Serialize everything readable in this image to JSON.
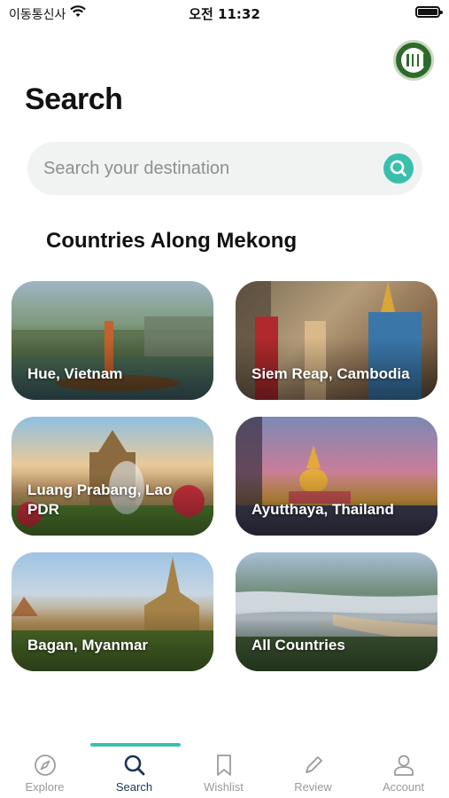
{
  "status_bar": {
    "carrier": "이동통신사",
    "time": "오전 11:32"
  },
  "header": {
    "title": "Search",
    "logo": "heritage-logo-badge"
  },
  "search": {
    "placeholder": "Search your destination",
    "value": "",
    "icon": "search-icon"
  },
  "section": {
    "title": "Countries Along Mekong"
  },
  "destinations": [
    {
      "label": "Hue, Vietnam"
    },
    {
      "label": "Siem Reap, Cambodia"
    },
    {
      "label": "Luang Prabang, Lao PDR"
    },
    {
      "label": "Ayutthaya, Thailand"
    },
    {
      "label": "Bagan, Myanmar"
    },
    {
      "label": "All Countries"
    }
  ],
  "tabs": [
    {
      "label": "Explore",
      "icon": "compass-icon",
      "active": false
    },
    {
      "label": "Search",
      "icon": "search-icon",
      "active": true
    },
    {
      "label": "Wishlist",
      "icon": "bookmark-icon",
      "active": false
    },
    {
      "label": "Review",
      "icon": "pencil-icon",
      "active": false
    },
    {
      "label": "Account",
      "icon": "person-icon",
      "active": false
    }
  ],
  "colors": {
    "accent": "#3bbfad",
    "active_tab": "#1d3557",
    "inactive_tab": "#9a9a9a",
    "search_bg": "#f1f3f2"
  }
}
